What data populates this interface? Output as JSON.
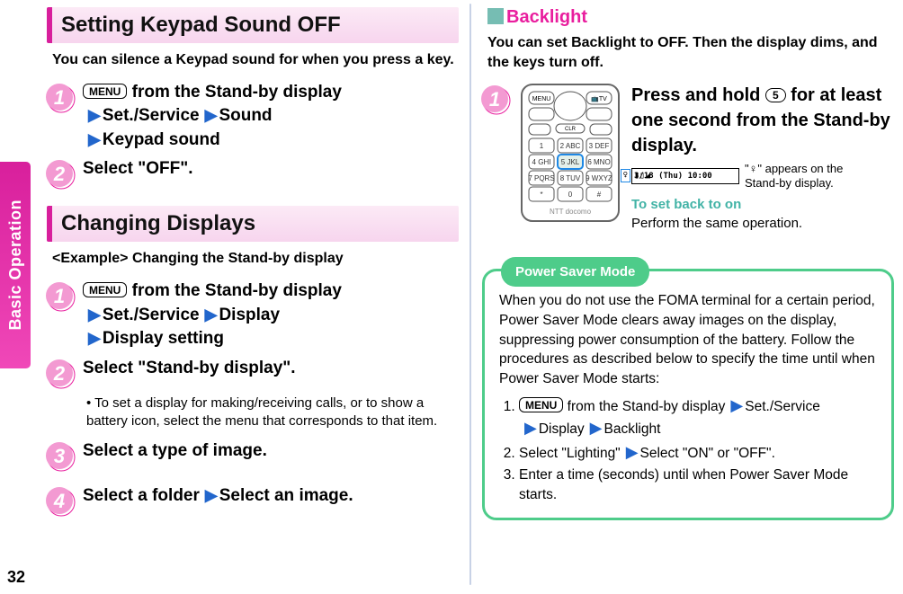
{
  "spine": {
    "tab_label": "Basic Operation",
    "page_number": "32"
  },
  "left": {
    "heading1": "Setting Keypad Sound OFF",
    "intro1": "You can silence a Keypad sound for when you press a key.",
    "step1a_menu": "MENU",
    "step1a_text": " from the Stand-by display",
    "step1a_l2a": "Set./Service",
    "step1a_l2b": "Sound",
    "step1a_l3": "Keypad sound",
    "step2a": "Select \"OFF\".",
    "heading2": "Changing Displays",
    "example": "<Example> Changing the Stand-by display",
    "step1b_menu": "MENU",
    "step1b_text": " from the Stand-by display",
    "step1b_l2a": "Set./Service",
    "step1b_l2b": "Display",
    "step1b_l3": "Display setting",
    "step2b": "Select \"Stand-by display\".",
    "bullet2b": "To set a display for making/receiving calls, or to show a battery icon, select the menu that corresponds to that item.",
    "step3b": "Select a type of image.",
    "step4b_a": "Select a folder",
    "step4b_b": "Select an image."
  },
  "right": {
    "sub_heading": "Backlight",
    "intro": "You can set Backlight to OFF. Then the display dims, and the keys turn off.",
    "step1_pre": "Press and hold ",
    "step1_key": "5",
    "step1_post": " for at least one second from the Stand-by display.",
    "status_time": "3/18 (Thu) 10:00",
    "status_note_a": "\"",
    "status_note_b": "\" appears on the Stand-by display.",
    "setback_label": "To set back to on",
    "setback_text": "Perform the same operation.",
    "pill_title": "Power Saver Mode",
    "pill_para": "When you do not use the FOMA terminal for a certain period, Power Saver Mode clears away images on the display, suppressing power consumption of the battery. Follow the procedures as described below to specify the time until when Power Saver Mode starts:",
    "pill1_menu": "MENU",
    "pill1_text": " from the Stand-by display",
    "pill1_a": "Set./Service",
    "pill1_b": "Display",
    "pill1_c": "Backlight",
    "pill2_a": "Select \"Lighting\"",
    "pill2_b": "Select \"ON\" or \"OFF\".",
    "pill3": "Enter a time (seconds) until when Power Saver Mode starts."
  }
}
